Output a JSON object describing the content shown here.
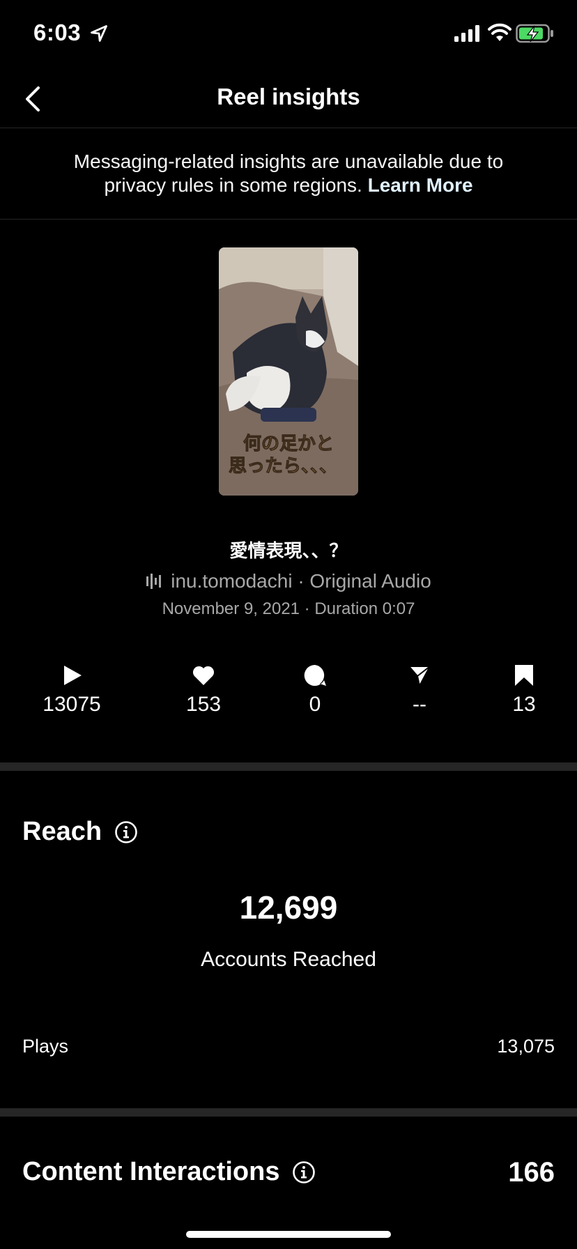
{
  "status_bar": {
    "time": "6:03"
  },
  "nav": {
    "title": "Reel insights"
  },
  "notice": {
    "text": "Messaging-related insights are unavailable due to privacy rules in some regions.",
    "link": "Learn More"
  },
  "reel": {
    "thumbnail_text_line1": "何の足かと",
    "thumbnail_text_line2": "思ったら、、、",
    "caption": "愛情表現、、？",
    "audio": "inu.tomodachi · Original Audio",
    "date_duration": "November 9, 2021 · Duration 0:07"
  },
  "stats": {
    "plays": "13075",
    "likes": "153",
    "comments": "0",
    "shares": "--",
    "saves": "13"
  },
  "reach": {
    "title": "Reach",
    "value": "12,699",
    "label": "Accounts Reached",
    "plays_label": "Plays",
    "plays_value": "13,075"
  },
  "content_interactions": {
    "title": "Content Interactions",
    "value": "166"
  }
}
